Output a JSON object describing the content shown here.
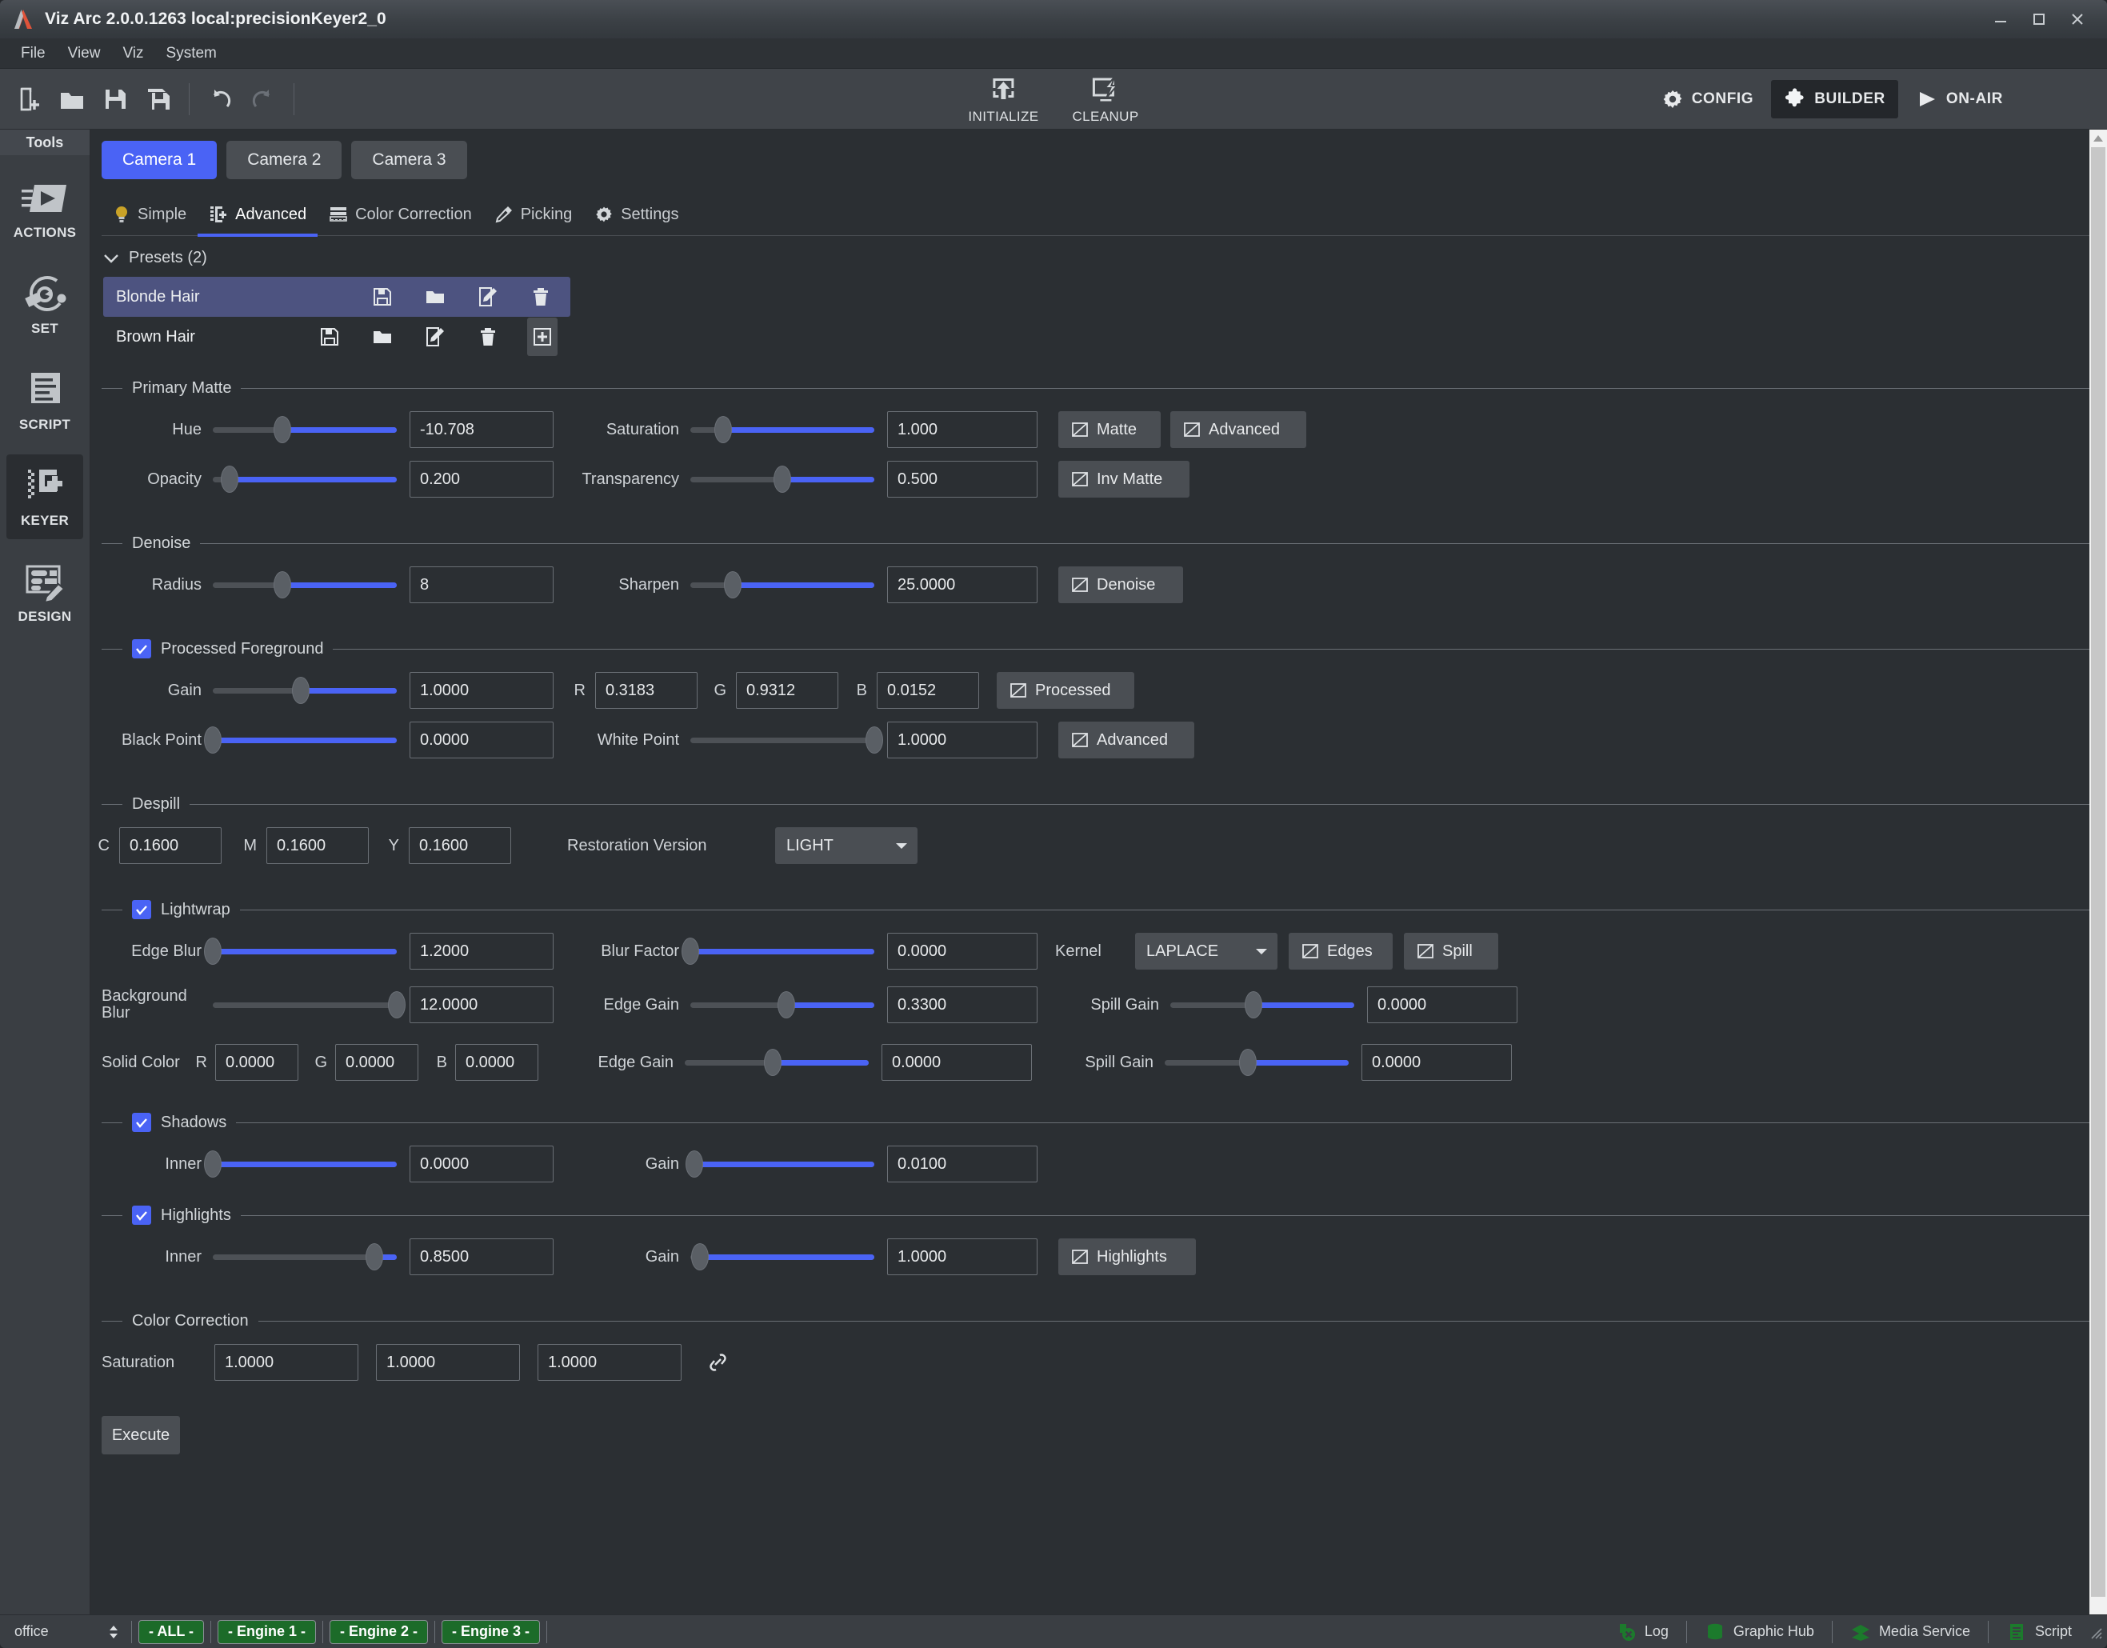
{
  "window": {
    "title": "Viz Arc 2.0.0.1263 local:precisionKeyer2_0",
    "minimize": "minimize-icon",
    "maximize": "maximize-icon",
    "close": "close-icon"
  },
  "menubar": {
    "items": [
      "File",
      "View",
      "Viz",
      "System"
    ]
  },
  "toolbar": {
    "left_icons": [
      "new-document-icon",
      "open-folder-icon",
      "save-icon",
      "save-as-icon",
      "undo-icon",
      "redo-icon"
    ],
    "center_buttons": [
      {
        "label": "INITIALIZE",
        "icon": "initialize-icon"
      },
      {
        "label": "CLEANUP",
        "icon": "cleanup-icon"
      }
    ],
    "modes": [
      {
        "label": "CONFIG",
        "icon": "gear-icon",
        "active": false
      },
      {
        "label": "BUILDER",
        "icon": "puzzle-icon",
        "active": true
      },
      {
        "label": "ON-AIR",
        "icon": "play-icon",
        "active": false
      }
    ]
  },
  "tools": {
    "header": "Tools",
    "items": [
      {
        "label": "ACTIONS",
        "icon": "actions-icon",
        "active": false
      },
      {
        "label": "SET",
        "icon": "set-icon",
        "active": false
      },
      {
        "label": "SCRIPT",
        "icon": "script-icon",
        "active": false
      },
      {
        "label": "KEYER",
        "icon": "keyer-icon",
        "active": true
      },
      {
        "label": "DESIGN",
        "icon": "design-icon",
        "active": false
      }
    ]
  },
  "camera_tabs": [
    {
      "label": "Camera 1",
      "active": true
    },
    {
      "label": "Camera 2",
      "active": false
    },
    {
      "label": "Camera 3",
      "active": false
    }
  ],
  "sub_tabs": [
    {
      "label": "Simple",
      "icon": "bulb-icon",
      "active": false
    },
    {
      "label": "Advanced",
      "icon": "advanced-icon",
      "active": true
    },
    {
      "label": "Color Correction",
      "icon": "color-correction-icon",
      "active": false
    },
    {
      "label": "Picking",
      "icon": "eyedropper-icon",
      "active": false
    },
    {
      "label": "Settings",
      "icon": "gear-icon",
      "active": false
    }
  ],
  "presets": {
    "header": "Presets (2)",
    "collapse_icon": "chevron-down-icon",
    "add_icon": "plus-icon",
    "row_icons": [
      "save-icon",
      "open-folder-icon",
      "edit-icon",
      "delete-icon"
    ],
    "items": [
      {
        "name": "Blonde Hair",
        "selected": true
      },
      {
        "name": "Brown Hair",
        "selected": false
      }
    ]
  },
  "sections": {
    "primary_matte": {
      "title": "Primary Matte",
      "hue": {
        "label": "Hue",
        "value": "-10.708",
        "knob_pct": 38
      },
      "saturation": {
        "label": "Saturation",
        "value": "1.000",
        "knob_pct": 18
      },
      "opacity": {
        "label": "Opacity",
        "value": "0.200",
        "knob_pct": 20
      },
      "transparency": {
        "label": "Transparency",
        "value": "0.500",
        "knob_pct": 50
      },
      "buttons": [
        {
          "label": "Matte",
          "icon": "preview-icon"
        },
        {
          "label": "Advanced",
          "icon": "preview-icon"
        },
        {
          "label": "Inv Matte",
          "icon": "preview-icon"
        }
      ]
    },
    "denoise": {
      "title": "Denoise",
      "radius": {
        "label": "Radius",
        "value": "8",
        "knob_pct": 38
      },
      "sharpen": {
        "label": "Sharpen",
        "value": "25.0000",
        "knob_pct": 23
      },
      "button": {
        "label": "Denoise",
        "icon": "preview-icon"
      }
    },
    "processed_foreground": {
      "title": "Processed Foreground",
      "checked": true,
      "gain": {
        "label": "Gain",
        "value": "1.0000",
        "knob_pct": 48
      },
      "r": {
        "label": "R",
        "value": "0.3183"
      },
      "g": {
        "label": "G",
        "value": "0.9312"
      },
      "b": {
        "label": "B",
        "value": "0.0152"
      },
      "processed_button": {
        "label": "Processed",
        "icon": "preview-icon"
      },
      "black_point": {
        "label": "Black Point",
        "value": "0.0000",
        "knob_pct": 0
      },
      "white_point": {
        "label": "White Point",
        "value": "1.0000",
        "knob_pct": 100
      },
      "advanced_button": {
        "label": "Advanced",
        "icon": "preview-icon"
      }
    },
    "despill": {
      "title": "Despill",
      "c": {
        "label": "C",
        "value": "0.1600"
      },
      "m": {
        "label": "M",
        "value": "0.1600"
      },
      "y": {
        "label": "Y",
        "value": "0.1600"
      },
      "restoration_version": {
        "label": "Restoration Version",
        "value": "LIGHT"
      }
    },
    "lightwrap": {
      "title": "Lightwrap",
      "checked": true,
      "edge_blur": {
        "label": "Edge Blur",
        "value": "1.2000",
        "knob_pct": 0
      },
      "blur_factor": {
        "label": "Blur Factor",
        "value": "0.0000",
        "knob_pct": 0
      },
      "kernel": {
        "label": "Kernel",
        "value": "LAPLACE"
      },
      "edges_button": {
        "label": "Edges",
        "icon": "preview-icon"
      },
      "spill_button": {
        "label": "Spill",
        "icon": "preview-icon"
      },
      "background_blur": {
        "label": "Background Blur",
        "value": "12.0000",
        "knob_pct": 100
      },
      "edge_gain_1": {
        "label": "Edge Gain",
        "value": "0.3300",
        "knob_pct": 52
      },
      "spill_gain_1": {
        "label": "Spill Gain",
        "value": "0.0000",
        "knob_pct": 45
      },
      "solid_color": {
        "label": "Solid Color",
        "r": "0.0000",
        "g": "0.0000",
        "b": "0.0000",
        "r_label": "R",
        "g_label": "G",
        "b_label": "B"
      },
      "edge_gain_2": {
        "label": "Edge Gain",
        "value": "0.0000",
        "knob_pct": 48
      },
      "spill_gain_2": {
        "label": "Spill Gain",
        "value": "0.0000",
        "knob_pct": 45
      }
    },
    "shadows": {
      "title": "Shadows",
      "checked": true,
      "inner": {
        "label": "Inner",
        "value": "0.0000",
        "knob_pct": 0
      },
      "gain": {
        "label": "Gain",
        "value": "0.0100",
        "knob_pct": 2
      }
    },
    "highlights": {
      "title": "Highlights",
      "checked": true,
      "inner": {
        "label": "Inner",
        "value": "0.8500",
        "knob_pct": 88
      },
      "gain": {
        "label": "Gain",
        "value": "1.0000",
        "knob_pct": 4
      },
      "button": {
        "label": "Highlights",
        "icon": "preview-icon"
      }
    },
    "color_correction": {
      "title": "Color Correction",
      "saturation_label": "Saturation",
      "v1": "1.0000",
      "v2": "1.0000",
      "v3": "1.0000",
      "link_icon": "link-icon"
    }
  },
  "execute_button": "Execute",
  "statusbar": {
    "office": "office",
    "engines": [
      {
        "label": "- ALL -"
      },
      {
        "label": "- Engine 1 -"
      },
      {
        "label": "- Engine 2 -"
      },
      {
        "label": "- Engine 3 -"
      }
    ],
    "right_items": [
      {
        "label": "Log",
        "icon": "log-icon"
      },
      {
        "label": "Graphic Hub",
        "icon": "database-icon"
      },
      {
        "label": "Media Service",
        "icon": "layers-icon"
      },
      {
        "label": "Script",
        "icon": "script-doc-icon"
      }
    ]
  },
  "colors": {
    "accent": "#4a63f5",
    "panel": "#2b2f33",
    "toolbar": "#404449",
    "engine_green": "#1c6b29",
    "preset_selected": "#4d5380"
  }
}
